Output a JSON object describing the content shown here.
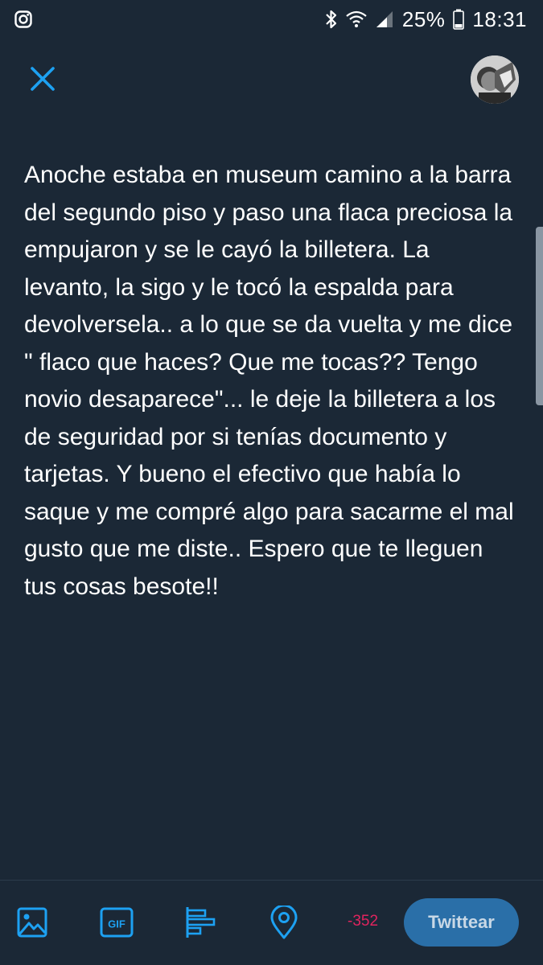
{
  "status_bar": {
    "battery": "25%",
    "time": "18:31",
    "icons": [
      "instagram-icon",
      "bluetooth-icon",
      "wifi-icon",
      "signal-icon",
      "battery-icon"
    ]
  },
  "header": {
    "close_icon": "close-icon",
    "avatar": "profile-avatar"
  },
  "compose": {
    "text": "Anoche estaba en museum camino a la barra del segundo piso y paso una flaca preciosa la empujaron y se le cayó la billetera. La levanto, la sigo y le tocó la espalda para devolversela.. a lo que se da vuelta y me dice \" flaco que haces? Que me tocas?? Tengo novio desaparece\"... le deje la billetera a los de seguridad por si tenías documento y tarjetas. Y bueno el efectivo que había lo saque y me compré algo para sacarme el mal gusto que me diste.. Espero que te lleguen tus cosas besote!!"
  },
  "toolbar": {
    "icons": [
      "image-icon",
      "gif-icon",
      "poll-icon",
      "location-icon"
    ],
    "gif_label": "GIF",
    "char_count": "-352",
    "tweet_label": "Twittear"
  },
  "colors": {
    "background": "#1b2836",
    "accent": "#1da1f2",
    "tweet_button": "#2a6fa8",
    "over_limit": "#e0245e"
  }
}
